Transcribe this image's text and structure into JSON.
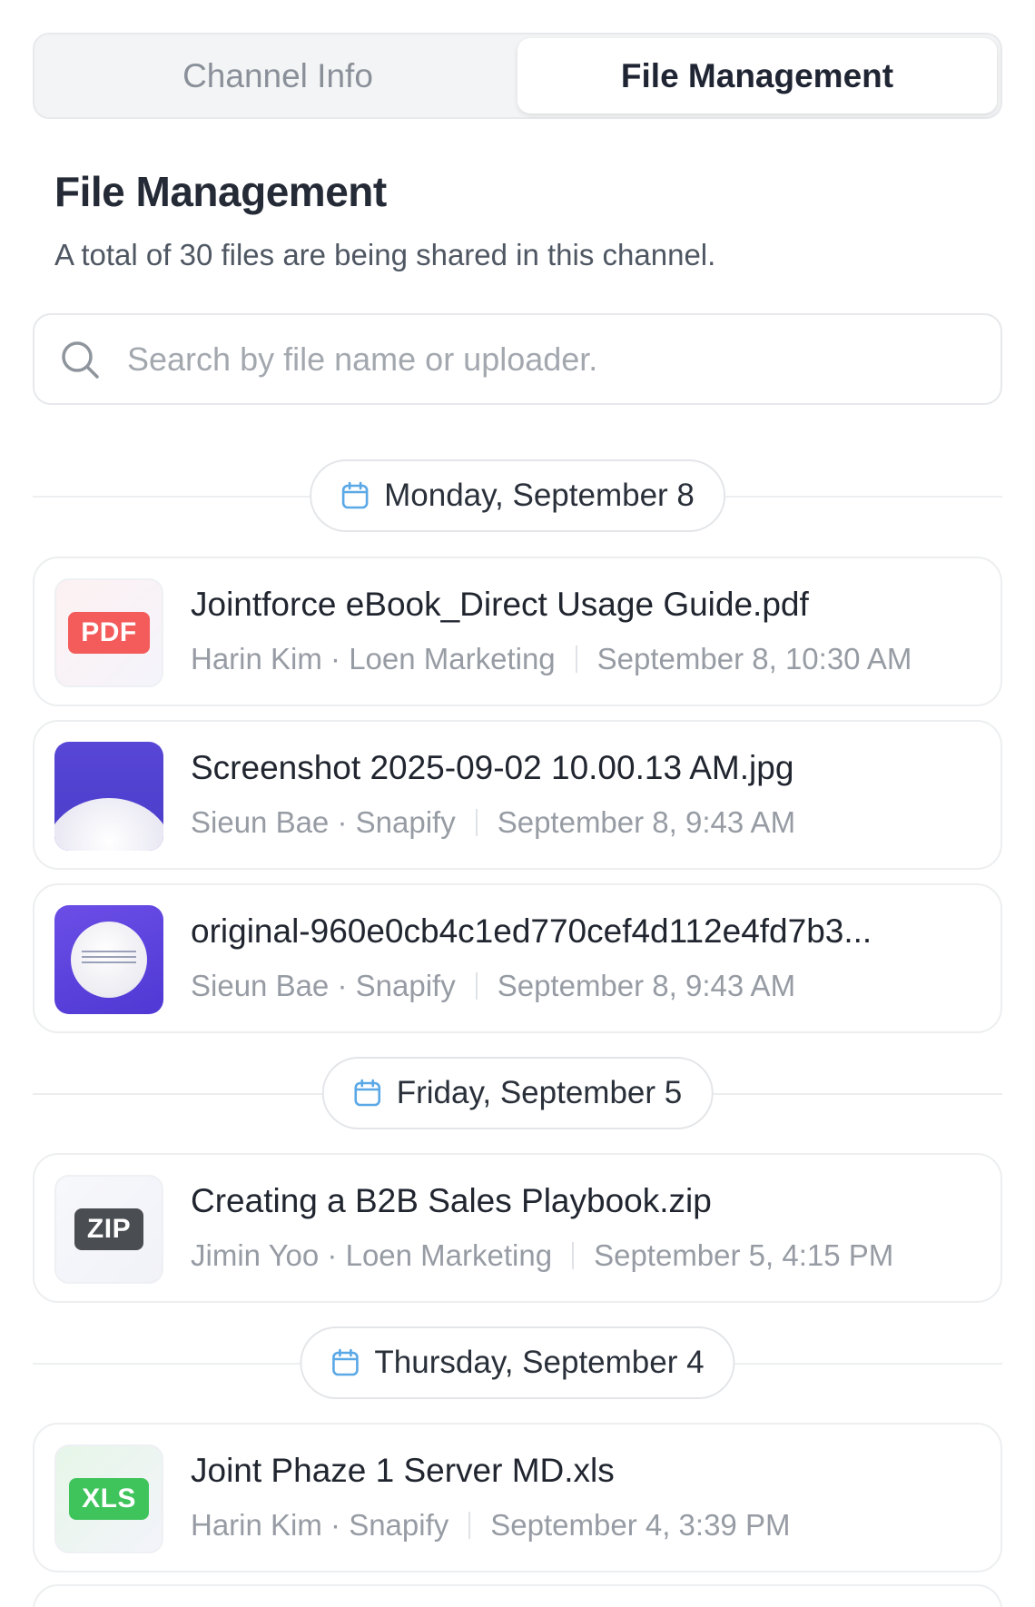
{
  "tabs": [
    {
      "label": "Channel Info",
      "active": false
    },
    {
      "label": "File Management",
      "active": true
    }
  ],
  "section": {
    "title": "File Management",
    "subtitle": "A total of 30 files are being shared in this channel."
  },
  "search": {
    "placeholder": "Search by file name or uploader.",
    "value": ""
  },
  "groups": [
    {
      "date": "Monday, September 8",
      "files": [
        {
          "name": "Jointforce eBook_Direct Usage Guide.pdf",
          "uploader": "Harin Kim",
          "org": "Loen Marketing",
          "time": "September 8, 10:30 AM",
          "type_badge": "PDF",
          "badge_color": "#f45b5b"
        },
        {
          "name": "Screenshot 2025-09-02 10.00.13 AM.jpg",
          "uploader": "Sieun Bae",
          "org": "Snapify",
          "time": "September 8, 9:43 AM",
          "type_badge": "",
          "badge_color": ""
        },
        {
          "name": "original-960e0cb4c1ed770cef4d112e4fd7b3...",
          "uploader": "Sieun Bae",
          "org": "Snapify",
          "time": "September 8, 9:43 AM",
          "type_badge": "",
          "badge_color": ""
        }
      ]
    },
    {
      "date": "Friday, September 5",
      "files": [
        {
          "name": "Creating a B2B Sales Playbook.zip",
          "uploader": "Jimin Yoo",
          "org": "Loen Marketing",
          "time": "September 5, 4:15 PM",
          "type_badge": "ZIP",
          "badge_color": "#4a4d52"
        }
      ]
    },
    {
      "date": "Thursday, September 4",
      "files": [
        {
          "name": "Joint Phaze 1 Server MD.xls",
          "uploader": "Harin Kim",
          "org": "Snapify",
          "time": "September 4, 3:39 PM",
          "type_badge": "XLS",
          "badge_color": "#3fc45c"
        }
      ]
    }
  ],
  "meta_separator": " · ",
  "icons": {
    "search": "search-icon",
    "calendar": "calendar-icon"
  },
  "colors": {
    "calendar_accent": "#5aa8e6",
    "pdf": "#f45b5b",
    "zip": "#4a4d52",
    "xls": "#3fc45c"
  }
}
